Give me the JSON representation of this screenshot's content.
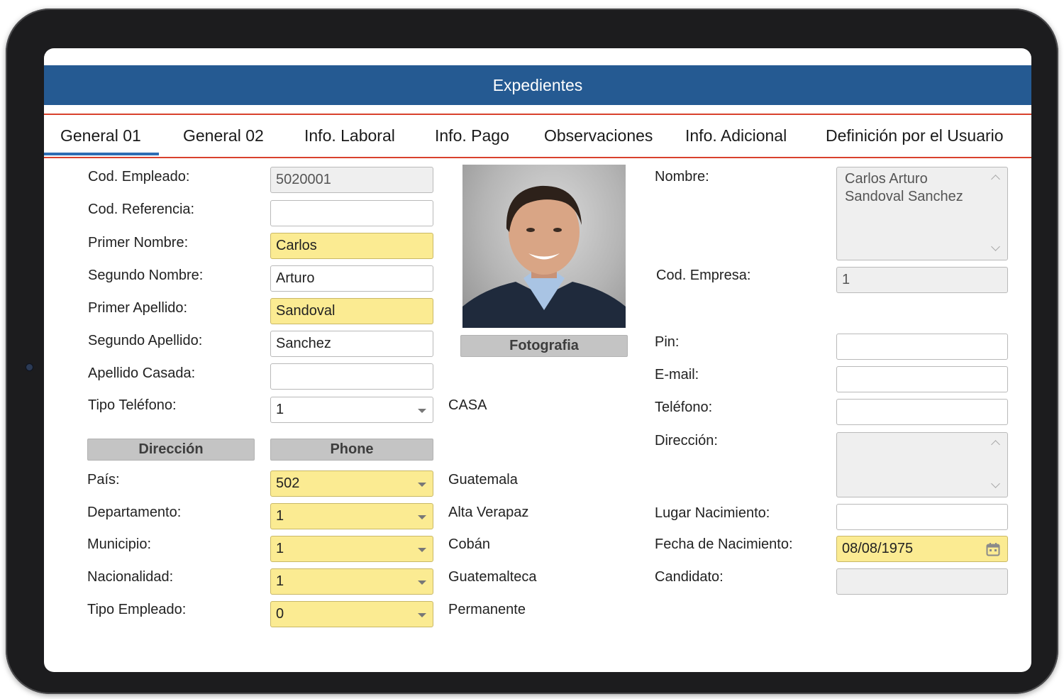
{
  "app": {
    "title": "Expedientes"
  },
  "tabs": [
    {
      "label": "General 01",
      "active": true
    },
    {
      "label": "General 02"
    },
    {
      "label": "Info. Laboral"
    },
    {
      "label": "Info. Pago"
    },
    {
      "label": "Observaciones"
    },
    {
      "label": "Info. Adicional"
    },
    {
      "label": "Definición por el Usuario"
    }
  ],
  "left": {
    "cod_empleado": {
      "label": "Cod. Empleado:",
      "value": "5020001"
    },
    "cod_referencia": {
      "label": "Cod. Referencia:",
      "value": ""
    },
    "primer_nombre": {
      "label": "Primer Nombre:",
      "value": "Carlos"
    },
    "segundo_nombre": {
      "label": "Segundo Nombre:",
      "value": "Arturo"
    },
    "primer_apellido": {
      "label": "Primer Apellido:",
      "value": "Sandoval"
    },
    "segundo_apellido": {
      "label": "Segundo Apellido:",
      "value": "Sanchez"
    },
    "apellido_casada": {
      "label": "Apellido Casada:",
      "value": ""
    },
    "tipo_telefono": {
      "label": "Tipo Teléfono:",
      "value": "1",
      "desc": "CASA"
    },
    "direccion_button": "Dirección",
    "phone_button": "Phone",
    "pais": {
      "label": "País:",
      "value": "502",
      "desc": "Guatemala"
    },
    "departamento": {
      "label": "Departamento:",
      "value": "1",
      "desc": "Alta Verapaz"
    },
    "municipio": {
      "label": "Municipio:",
      "value": "1",
      "desc": "Cobán"
    },
    "nacionalidad": {
      "label": "Nacionalidad:",
      "value": "1",
      "desc": "Guatemalteca"
    },
    "tipo_empleado": {
      "label": "Tipo Empleado:",
      "value": "0",
      "desc": "Permanente"
    }
  },
  "photo": {
    "button": "Fotografia"
  },
  "right": {
    "nombre": {
      "label": "Nombre:",
      "line1": "Carlos Arturo",
      "line2": "Sandoval Sanchez"
    },
    "cod_empresa": {
      "label": "Cod. Empresa:",
      "value": "1"
    },
    "pin": {
      "label": "Pin:",
      "value": ""
    },
    "email": {
      "label": "E-mail:",
      "value": ""
    },
    "telefono": {
      "label": "Teléfono:",
      "value": ""
    },
    "direccion": {
      "label": "Dirección:",
      "value": ""
    },
    "lugar_nacimiento": {
      "label": "Lugar Nacimiento:",
      "value": ""
    },
    "fecha_nacimiento": {
      "label": "Fecha de Nacimiento:",
      "value": "08/08/1975"
    },
    "candidato": {
      "label": "Candidato:",
      "value": ""
    }
  },
  "colors": {
    "header": "#255a92",
    "tab_rule": "#d9412d",
    "active_tab": "#2e6db4",
    "required_field": "#fbeb92",
    "readonly_field": "#efefef"
  }
}
